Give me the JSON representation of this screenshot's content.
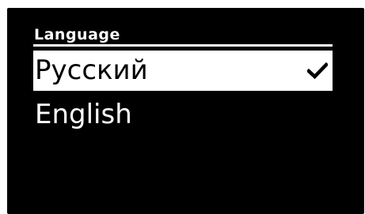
{
  "screen": {
    "title": "Language",
    "options": [
      {
        "label": "Русский",
        "selected": true,
        "icon": "check-icon"
      },
      {
        "label": "English",
        "selected": false
      }
    ]
  },
  "colors": {
    "screen_background": "#000000",
    "text": "#ffffff",
    "highlight_background": "#ffffff",
    "highlight_text": "#000000"
  }
}
